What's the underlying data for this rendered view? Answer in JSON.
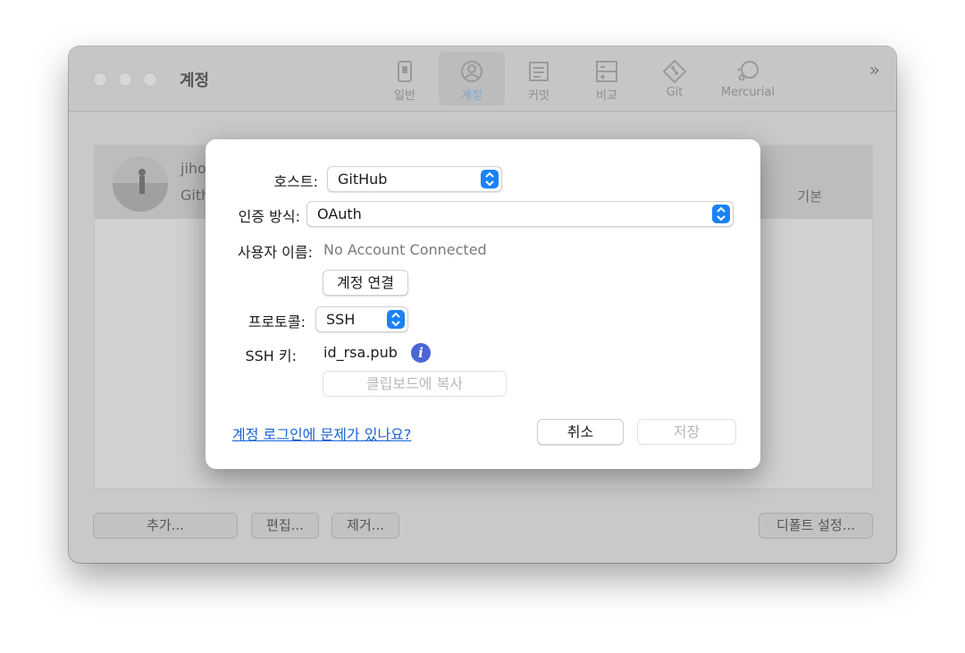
{
  "window": {
    "title": "계정",
    "toolbar": [
      {
        "label": "일반",
        "icon": "general-icon"
      },
      {
        "label": "계정",
        "icon": "account-icon",
        "active": true
      },
      {
        "label": "커밋",
        "icon": "commit-icon"
      },
      {
        "label": "비교",
        "icon": "diff-icon"
      },
      {
        "label": "Git",
        "icon": "git-icon"
      },
      {
        "label": "Mercurial",
        "icon": "mercurial-icon"
      }
    ],
    "overflow_label": "»"
  },
  "accounts": {
    "row": {
      "name": "jiho",
      "host": "Gith",
      "default": "기본"
    }
  },
  "bottom_buttons": {
    "add": "추가...",
    "edit": "편집...",
    "remove": "제거...",
    "set_default": "디폴트 설정..."
  },
  "sheet": {
    "host_label": "호스트:",
    "host_value": "GitHub",
    "auth_label": "인증 방식:",
    "auth_value": "OAuth",
    "username_label": "사용자 이름:",
    "username_value": "No Account Connected",
    "connect_button": "계정 연결",
    "protocol_label": "프로토콜:",
    "protocol_value": "SSH",
    "ssh_key_label": "SSH 키:",
    "ssh_key_value": "id_rsa.pub",
    "copy_button": "클립보드에 복사",
    "help_link": "계정 로그인에 문제가 있나요?",
    "cancel_button": "취소",
    "save_button": "저장"
  },
  "colors": {
    "accent": "#1a82f7",
    "link": "#1863d6",
    "info_icon": "#4a66d6"
  }
}
